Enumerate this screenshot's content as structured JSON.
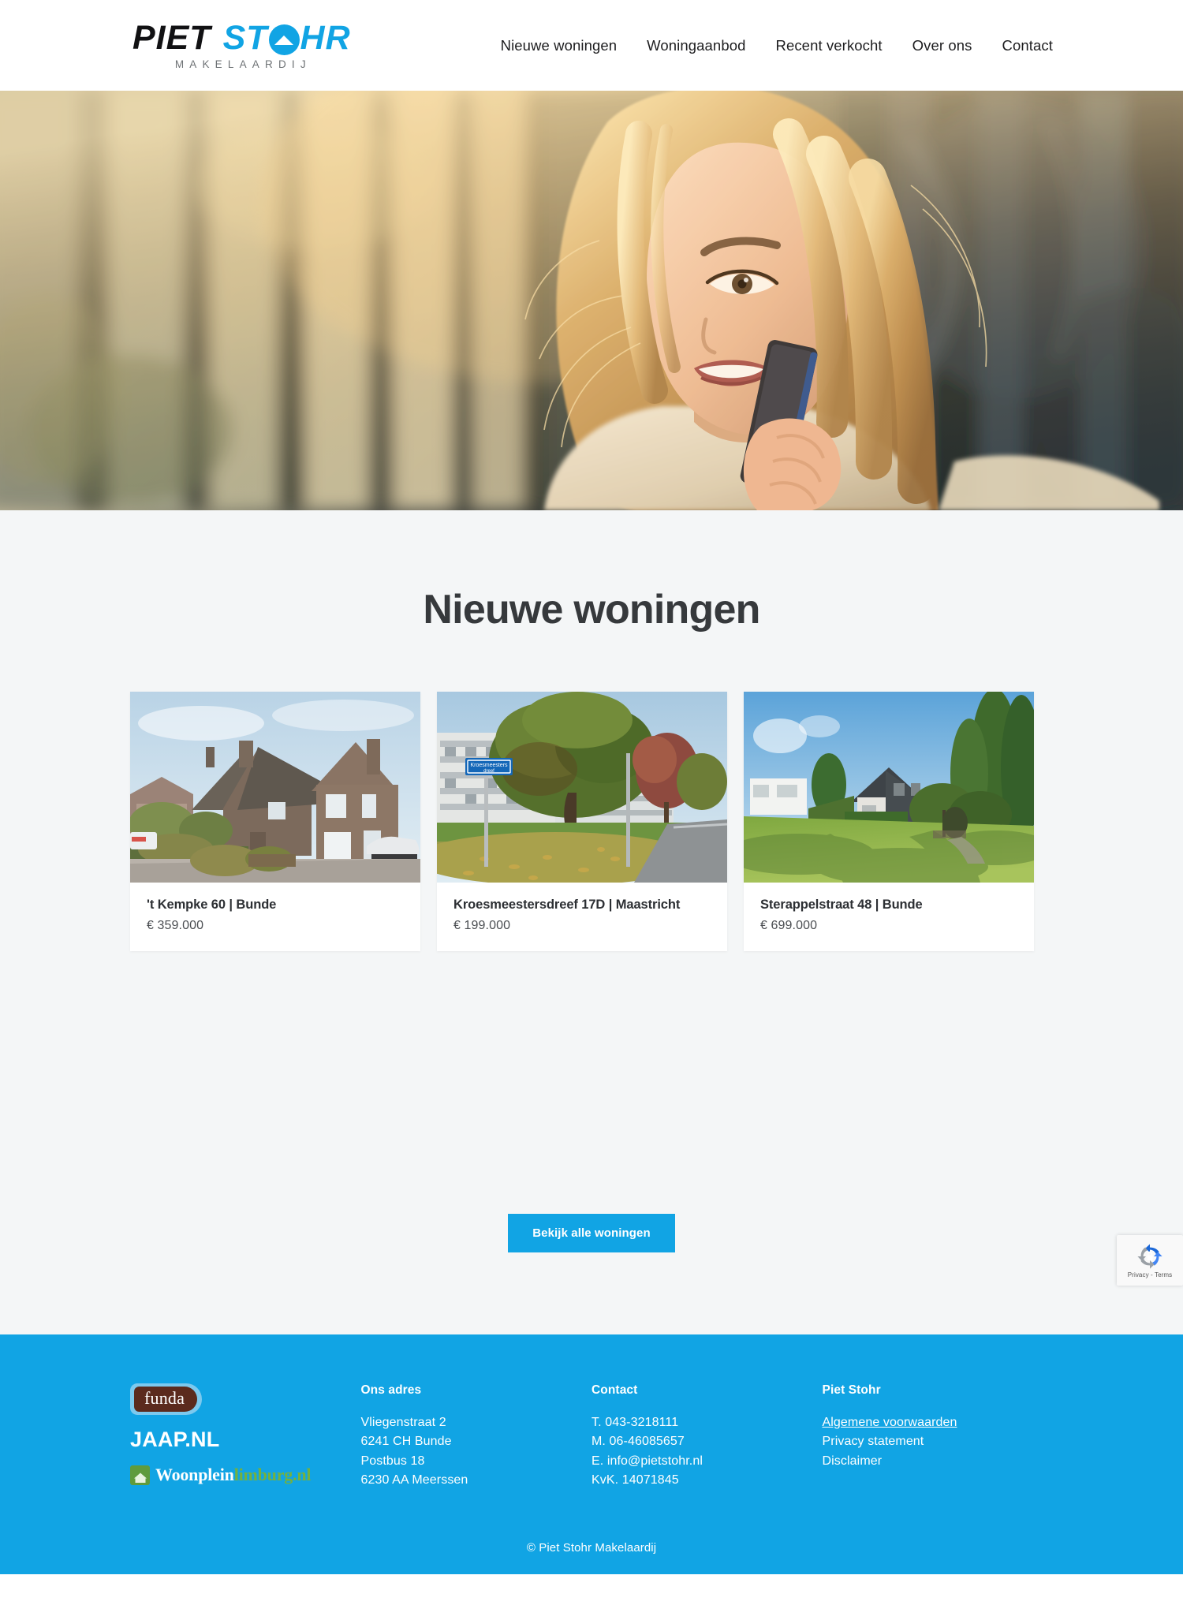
{
  "header": {
    "logo": {
      "name": "Piet Stohr Makelaardij",
      "part1": "PIET",
      "part2": "ST",
      "part3": "HR",
      "subtitle": "MAKELAARDIJ",
      "brand_blue": "#11a4e4",
      "brand_black": "#111113"
    },
    "nav": [
      {
        "label": "Nieuwe woningen",
        "name": "nav-nieuwe-woningen"
      },
      {
        "label": "Woningaanbod",
        "name": "nav-woningaanbod"
      },
      {
        "label": "Recent verkocht",
        "name": "nav-recent-verkocht"
      },
      {
        "label": "Over ons",
        "name": "nav-over-ons"
      },
      {
        "label": "Contact",
        "name": "nav-contact"
      }
    ]
  },
  "hero": {
    "image_alt": "Glimlachende vrouw met telefoon in tegenlicht voor kantoorgebouw"
  },
  "listings": {
    "title": "Nieuwe woningen",
    "background": "#f4f6f7",
    "cards": [
      {
        "title": "'t Kempke 60 | Bunde",
        "price": "€ 359.000",
        "image_alt": "Bakstenen eengezinswoning met voortuin"
      },
      {
        "title": "Kroesmeestersdreef 17D | Maastricht",
        "price": "€ 199.000",
        "image_alt": "Appartementencomplex met boom en straatnaambord"
      },
      {
        "title": "Sterappelstraat 48 | Bunde",
        "price": "€ 699.000",
        "image_alt": "Woning met ruime tuin en bomen"
      }
    ],
    "cta_label": "Bekijk alle woningen",
    "cta_color": "#11a4e4"
  },
  "recaptcha": {
    "privacy": "Privacy",
    "separator": "-",
    "terms": "Terms"
  },
  "footer": {
    "background": "#11a4e4",
    "partner_logos": {
      "funda": "funda",
      "jaap": "JAAP.NL",
      "woonplein_white": "Woonplein",
      "woonplein_green": "limburg.nl"
    },
    "address": {
      "heading": "Ons adres",
      "lines": [
        "Vliegenstraat 2",
        "6241 CH Bunde",
        "Postbus 18",
        "6230 AA Meerssen"
      ]
    },
    "contact": {
      "heading": "Contact",
      "lines": [
        "T. 043-3218111",
        "M. 06-46085657",
        "E. info@pietstohr.nl",
        "KvK. 14071845"
      ]
    },
    "company": {
      "heading": "Piet Stohr",
      "links": [
        "Algemene voorwaarden",
        "Privacy statement",
        "Disclaimer"
      ]
    },
    "copyright": "© Piet Stohr Makelaardij"
  }
}
